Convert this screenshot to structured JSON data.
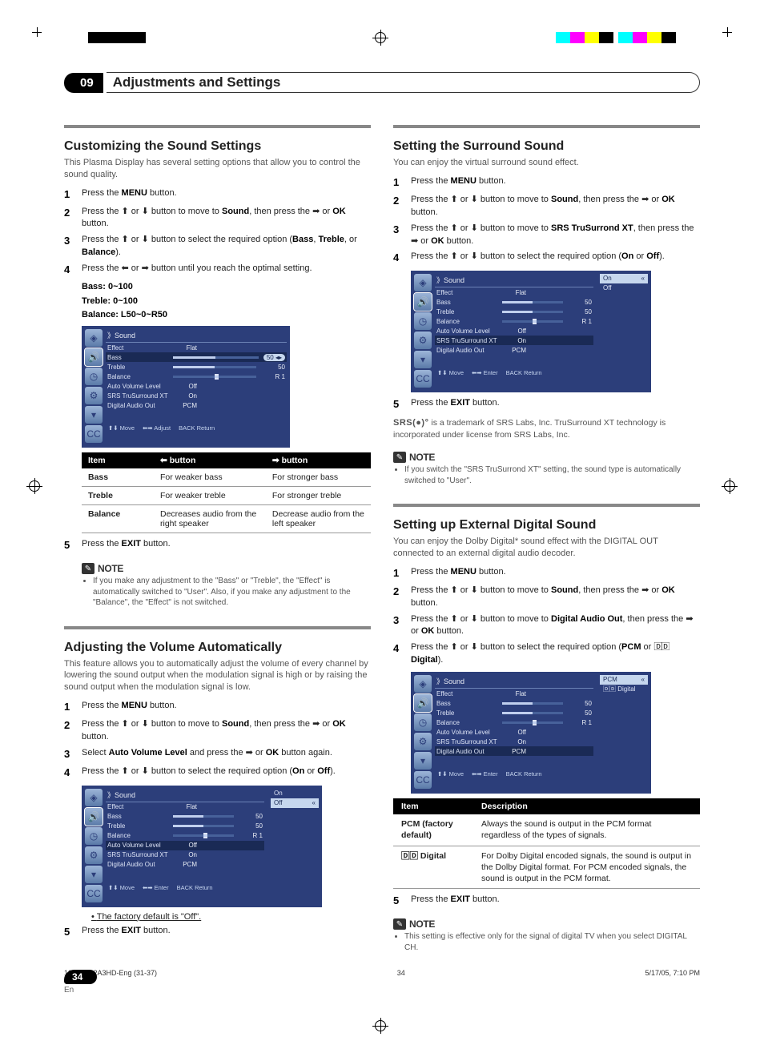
{
  "chapter": {
    "number": "09",
    "title": "Adjustments and Settings"
  },
  "sec_custom": {
    "title": "Customizing the Sound Settings",
    "intro": "This Plasma Display has several setting options that allow you to control the sound quality.",
    "s1": "Press the MENU button.",
    "s2a": "Press the ",
    "s2b": " or ",
    "s2c": " button to move to ",
    "s2d": "Sound",
    "s2e": ", then press the ",
    "s2f": " or ",
    "s2g": "OK",
    "s2h": " button.",
    "s3a": "Press the ",
    "s3b": " or ",
    "s3c": " button to select the required option (",
    "s3d": "Bass",
    "s3e": ", ",
    "s3f": "Treble",
    "s3g": ", or ",
    "s3h": "Balance",
    "s3i": ").",
    "s4a": "Press the ",
    "s4b": " or ",
    "s4c": " button until you reach the optimal setting.",
    "ranges": {
      "bass": "Bass: 0~100",
      "treble": "Treble: 0~100",
      "balance": "Balance: L50~0~R50"
    },
    "s5": "Press the EXIT button.",
    "note": "If you make any adjustment to the \"Bass\" or \"Treble\", the \"Effect\" is automatically switched to \"User\". Also, if you make any adjustment to the \"Balance\", the \"Effect\" is not switched."
  },
  "tbl_buttons": {
    "h_item": "Item",
    "h_left": "⬅ button",
    "h_right": "➡ button",
    "rows": [
      {
        "k": "Bass",
        "l": "For weaker bass",
        "r": "For stronger bass"
      },
      {
        "k": "Treble",
        "l": "For weaker treble",
        "r": "For stronger treble"
      },
      {
        "k": "Balance",
        "l": "Decreases audio from the right speaker",
        "r": "Decrease audio from the left speaker"
      }
    ]
  },
  "sec_auto": {
    "title": "Adjusting the Volume Automatically",
    "intro": "This feature allows you to automatically adjust the volume of every channel by lowering the sound output when the modulation signal is high or by raising the sound output when the modulation signal is low.",
    "s1": "Press the MENU button.",
    "s2a": "Press the ",
    "s2d": "Sound",
    "s2e": ", then press the ",
    "s2g": "OK",
    "s2h": " button.",
    "s3a": "Select ",
    "s3b": "Auto Volume Level",
    "s3c": " and press the ",
    "s3d": " or ",
    "s3e": "OK",
    "s3f": " button again.",
    "s4a": "Press the ",
    "s4b": " button to select the required option (",
    "s4c": "On",
    "s4d": " or ",
    "s4e": "Off",
    "s4f": ").",
    "default": "The factory default is \"Off\".",
    "s5": "Press the EXIT button."
  },
  "sec_surround": {
    "title": "Setting the Surround Sound",
    "intro": "You can enjoy the virtual surround sound effect.",
    "s1": "Press the MENU button.",
    "s3a": "Press the ",
    "s3b": " button to move to ",
    "s3c": "SRS TruSurrond XT",
    "s3d": ", then press the ",
    "s3e": " or ",
    "s3f": "OK",
    "s3g": " button.",
    "s4a": "Press the ",
    "s4b": " button to select the required option (",
    "s4c": "On",
    "s4d": " or ",
    "s4e": "Off",
    "s4f": ").",
    "s5": "Press the EXIT button.",
    "srs_line": " is a trademark of SRS Labs, Inc. TruSurround XT technology is incorporated under license from SRS Labs, Inc.",
    "note": "If you switch the \"SRS TruSurrond XT\" setting, the sound type is automatically switched to \"User\"."
  },
  "sec_digital": {
    "title": "Setting up External Digital Sound",
    "intro": "You can enjoy the Dolby Digital* sound effect with the DIGITAL OUT connected to an external digital audio decoder.",
    "s1": "Press the MENU button.",
    "s3a": "Press the ",
    "s3b": " button to move to ",
    "s3c": "Digital Audio Out",
    "s3d": ", then press the ",
    "s3f": "OK",
    "s3g": " button.",
    "s4a": "Press the ",
    "s4b": " button to select the required option (",
    "s4c": "PCM",
    "s4d": " or ",
    "s4e": "Digital",
    "s4f": ").",
    "s5": "Press the EXIT button.",
    "note": "This setting is effective only for the signal of digital TV when you select DIGITAL CH."
  },
  "tbl_digital": {
    "h_item": "Item",
    "h_desc": "Description",
    "rows": [
      {
        "k": "PCM (factory default)",
        "d": "Always the sound is output in the PCM format regardless of the types of signals."
      },
      {
        "k": "🄳🄳 Digital",
        "d": "For Dolby Digital encoded signals, the sound is output in the Dolby Digital format. For PCM encoded signals, the sound is output in the PCM format."
      }
    ]
  },
  "osd": {
    "title": "》Sound",
    "rows": [
      {
        "k": "Effect",
        "v": "Flat"
      },
      {
        "k": "Bass",
        "v": "50",
        "bar": true
      },
      {
        "k": "Treble",
        "v": "50",
        "bar": true
      },
      {
        "k": "Balance",
        "v": "R 1",
        "bal": true
      },
      {
        "k": "Auto Volume Level",
        "v": "Off"
      },
      {
        "k": "SRS TruSurround XT",
        "v": "On"
      },
      {
        "k": "Digital Audio Out",
        "v": "PCM"
      }
    ],
    "opts_onoff": [
      "On",
      "Off"
    ],
    "opts_pcm": [
      "PCM",
      "🄳🄳 Digital"
    ],
    "foot_move": "⬆⬇ Move",
    "foot_enter": "⬅➡ Enter",
    "foot_adjust": "⬅➡ Adjust",
    "foot_return": "BACK Return"
  },
  "note_label": "NOTE",
  "page_num": "34",
  "lang": "En",
  "footline_left": "10-PDP42A3HD-Eng (31-37)",
  "footline_mid": "34",
  "footline_right": "5/17/05, 7:10 PM",
  "srs_logo": "SRS(●)°"
}
